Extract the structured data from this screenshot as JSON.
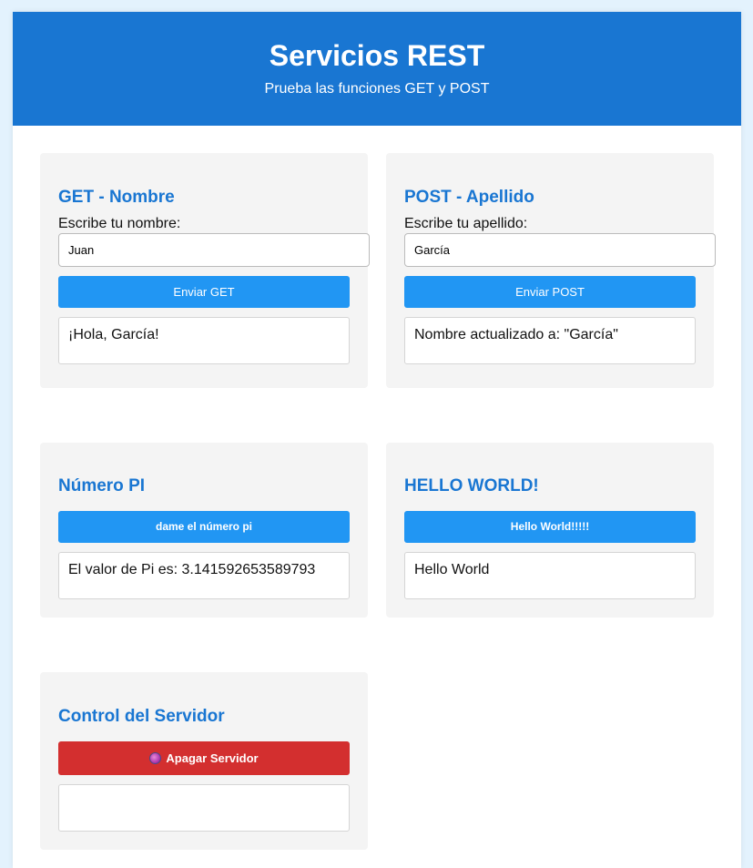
{
  "header": {
    "title": "Servicios REST",
    "subtitle": "Prueba las funciones GET y POST"
  },
  "get_card": {
    "title": "GET - Nombre",
    "label": "Escribe tu nombre:",
    "input_value": "Juan",
    "button": "Enviar GET",
    "output": "¡Hola, García!"
  },
  "post_card": {
    "title": "POST - Apellido",
    "label": "Escribe tu apellido:",
    "input_value": "García",
    "button": "Enviar POST",
    "output": "Nombre actualizado a: \"García\""
  },
  "pi_card": {
    "title": "Número PI",
    "button": "dame el número pi",
    "output": "El valor de Pi es: 3.141592653589793"
  },
  "hello_card": {
    "title": "HELLO WORLD!",
    "button": "Hello World!!!!!",
    "output": "Hello World"
  },
  "server_card": {
    "title": "Control del Servidor",
    "button": "Apagar Servidor",
    "button_icon": "power-icon",
    "output": ""
  },
  "colors": {
    "primary": "#1976d2",
    "button": "#2196f3",
    "danger": "#d32f2f",
    "background": "#e3f2fd"
  }
}
